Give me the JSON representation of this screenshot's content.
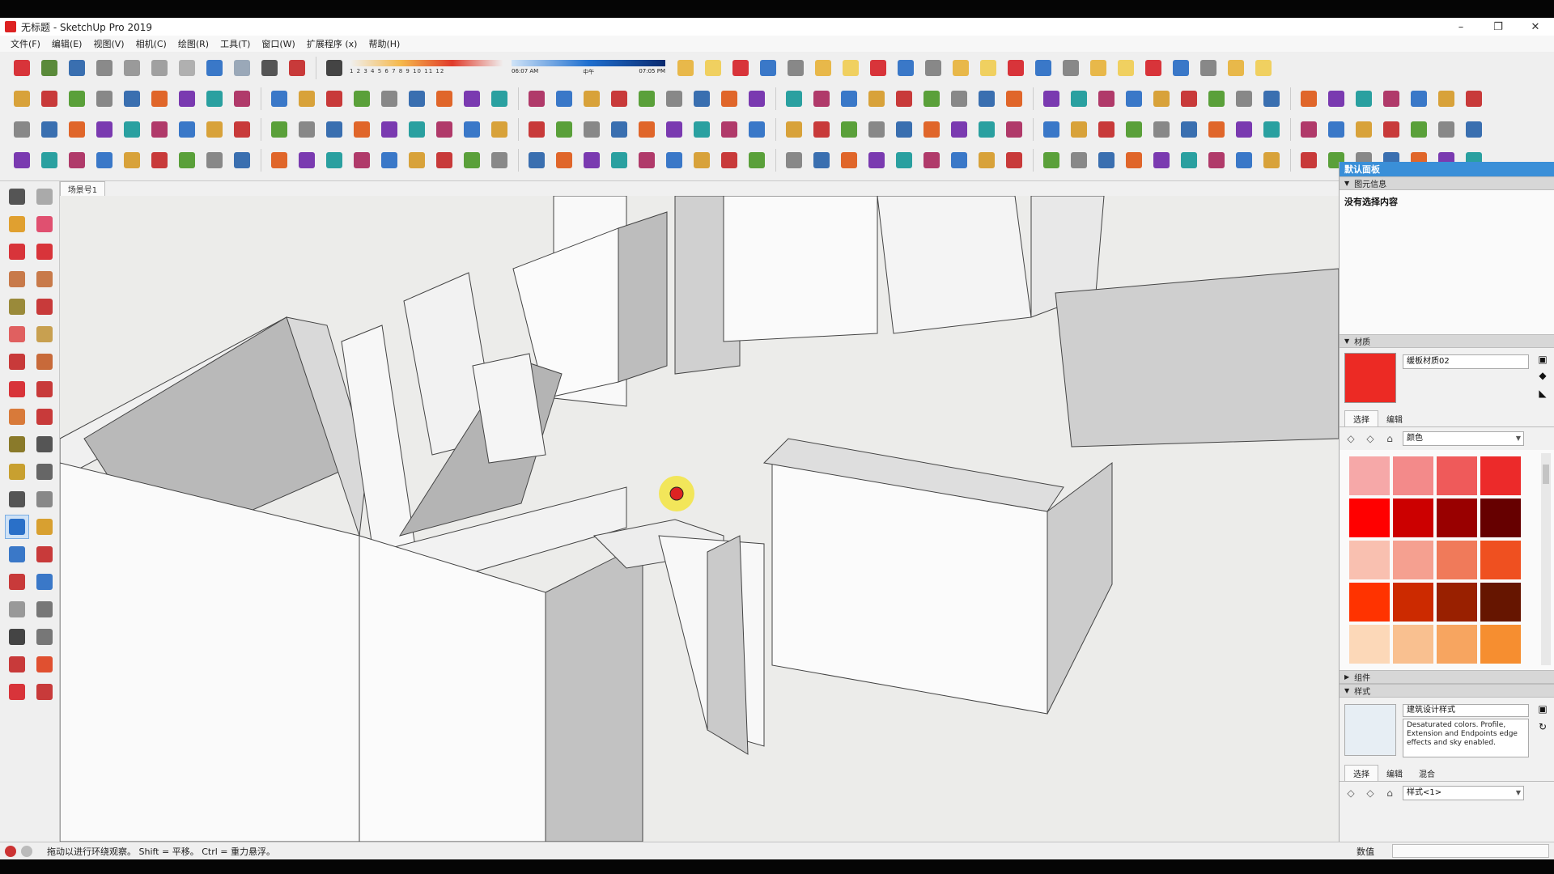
{
  "window": {
    "title": "无标题 - SketchUp Pro 2019",
    "controls": {
      "minimize": "–",
      "restore": "❐",
      "close": "✕"
    }
  },
  "menu": [
    "文件(F)",
    "编辑(E)",
    "视图(V)",
    "相机(C)",
    "绘图(R)",
    "工具(T)",
    "窗口(W)",
    "扩展程序 (x)",
    "帮助(H)"
  ],
  "shadow": {
    "months": "1 2 3 4 5 6 7 8 9 10 11 12",
    "time_start": "06:07 AM",
    "time_mid": "中午",
    "time_end": "07:05 PM"
  },
  "scene_tab": "场景号1",
  "panel": {
    "title": "默认面板",
    "entity_info": {
      "header": "图元信息",
      "content": "没有选择内容"
    },
    "materials": {
      "header": "材质",
      "name": "缓板材质02",
      "swatch_color": "#ec2a24",
      "tab_select": "选择",
      "tab_edit": "编辑",
      "library": "颜色",
      "palette": [
        "#f6a8a8",
        "#f38a8a",
        "#ef5a5a",
        "#ec2a2a",
        "#ff0000",
        "#cc0000",
        "#990000",
        "#660000",
        "#f9c0b0",
        "#f5a090",
        "#f07a5a",
        "#ef5020",
        "#ff3300",
        "#cc2a00",
        "#992000",
        "#661500",
        "#fcd8b8",
        "#f9c090",
        "#f7a560",
        "#f68e30"
      ]
    },
    "components": {
      "header": "组件"
    },
    "styles": {
      "header": "样式",
      "name": "建筑设计样式",
      "description": "Desaturated colors. Profile, Extension and Endpoints edge effects and sky enabled.",
      "tab_select": "选择",
      "tab_edit": "编辑",
      "tab_mix": "混合",
      "library": "样式<1>"
    }
  },
  "status": {
    "hint": "拖动以进行环绕观察。 Shift = 平移。 Ctrl = 重力悬浮。",
    "measurements_label": "数值"
  }
}
